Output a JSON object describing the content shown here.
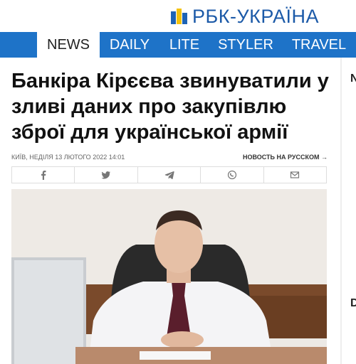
{
  "header": {
    "logo_text": "РБК-УКРАЇНА"
  },
  "nav": [
    {
      "label": "NEWS",
      "active": true
    },
    {
      "label": "DAILY"
    },
    {
      "label": "LITE"
    },
    {
      "label": "STYLER"
    },
    {
      "label": "TRAVEL"
    }
  ],
  "article": {
    "title": "Банкіра Кірєєва звинуватили у зливі даних про закупівлю зброї для української армії",
    "meta": "КИЇВ, НЕДІЛЯ 13 ЛЮТОГО 2022 14:01",
    "ru_link": "НОВОСТЬ НА РУССКОМ →"
  },
  "share": [
    {
      "icon": "facebook-icon"
    },
    {
      "icon": "twitter-icon"
    },
    {
      "icon": "telegram-icon"
    },
    {
      "icon": "viber-icon"
    },
    {
      "icon": "email-icon"
    }
  ],
  "rail": {
    "top_letter": "N",
    "bottom_letter": "D"
  },
  "colors": {
    "nav_bg": "#1e73c8",
    "logo_blue": "#1c5aa8",
    "logo_yellow": "#f4c20d"
  }
}
